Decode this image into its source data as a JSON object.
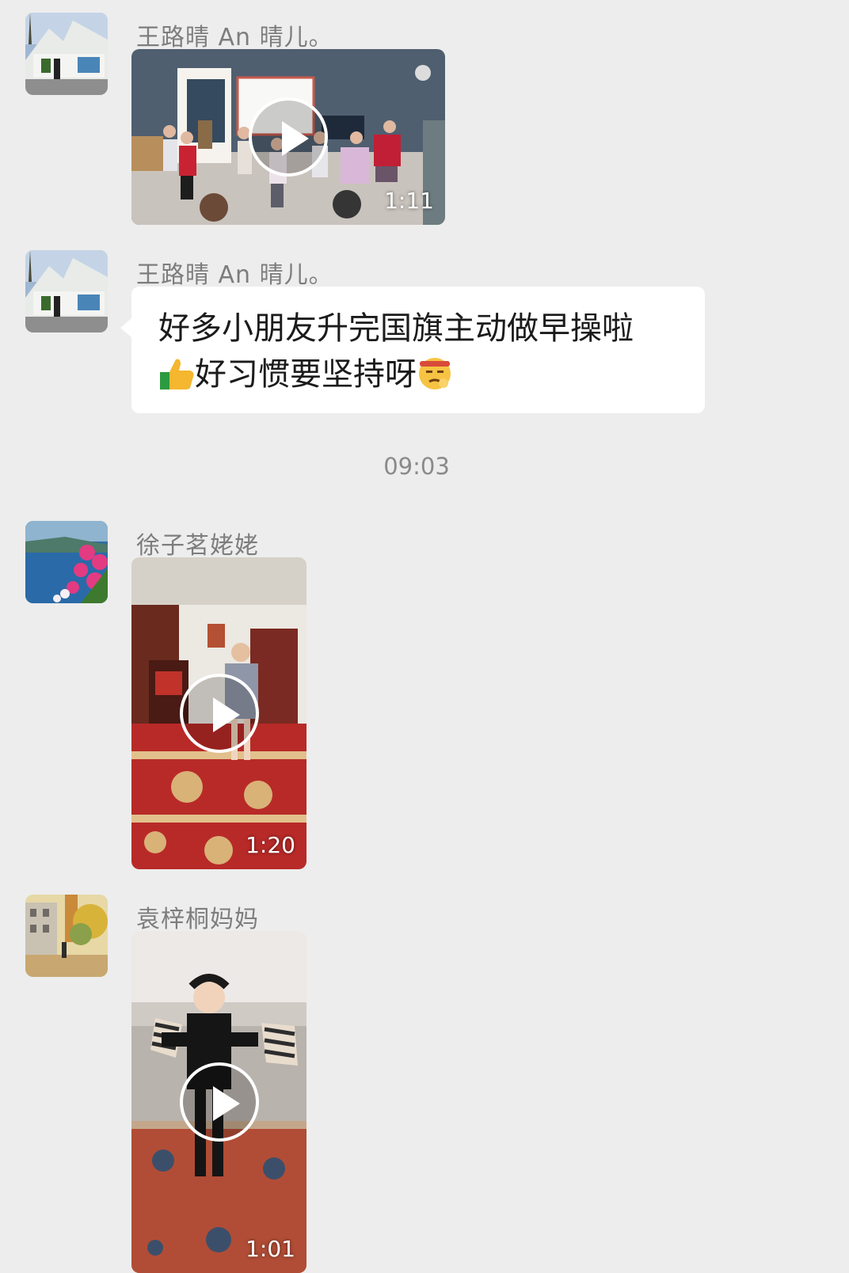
{
  "messages": [
    {
      "sender": "王路晴  An 晴儿。",
      "type": "video",
      "duration": "1:11",
      "avatar_icon": "street-photo-avatar"
    },
    {
      "sender": "王路晴  An 晴儿。",
      "type": "text",
      "text_line1": "好多小朋友升完国旗主动做早操啦",
      "text_line2": "好习惯要坚持呀",
      "emoji_icons": [
        "thumbs-up-icon",
        "determined-face-icon"
      ],
      "avatar_icon": "street-photo-avatar"
    },
    {
      "type": "timestamp",
      "text": "09:03"
    },
    {
      "sender": "徐子茗姥姥",
      "type": "video",
      "duration": "1:20",
      "avatar_icon": "lake-flowers-avatar"
    },
    {
      "sender": "袁梓桐妈妈",
      "type": "video",
      "duration": "1:01",
      "avatar_icon": "painting-avatar"
    }
  ],
  "colors": {
    "background": "#ededed",
    "bubble": "#ffffff",
    "sender_text": "#7d7d7d"
  }
}
